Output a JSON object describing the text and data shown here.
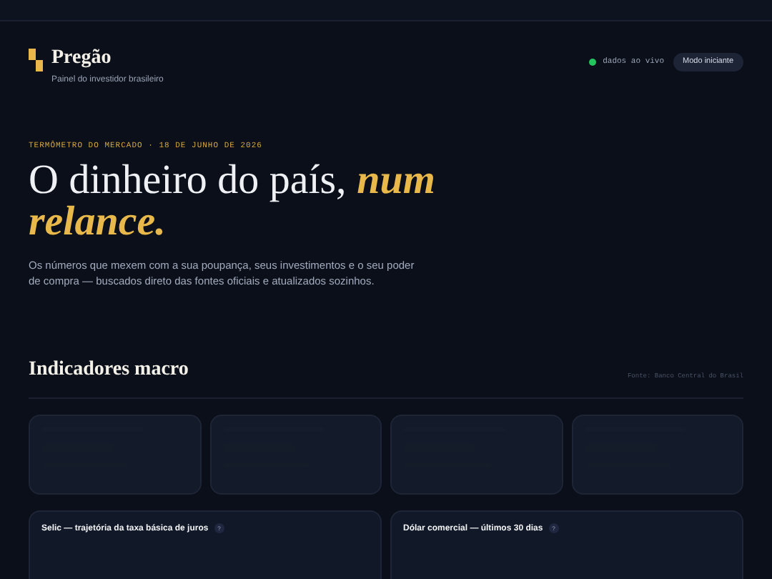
{
  "brand": {
    "name": "Pregão",
    "tagline": "Painel do investidor brasileiro"
  },
  "status": {
    "live": true,
    "label": "dados ao vivo"
  },
  "mode_button": "Modo iniciante",
  "hero": {
    "eyebrow": "TERMÔMETRO DO MERCADO · 18 DE JUNHO DE 2026",
    "headline": "O dinheiro do país, *num relance.*",
    "intro": "Os números que mexem com a sua poupança, seus investimentos e o seu poder de compra — buscados direto das fontes oficiais e atualizados sozinhos."
  },
  "section": {
    "title": "Indicadores macro",
    "source": "Fonte: Banco Central do Brasil"
  },
  "indicator_cards": [
    {
      "loading": true
    },
    {
      "loading": true
    },
    {
      "loading": true
    },
    {
      "loading": true
    }
  ],
  "chart_cards": [
    {
      "title": "Selic — trajetória da taxa básica de juros",
      "help": "?"
    },
    {
      "title": "Dólar comercial — últimos 30 dias",
      "help": "?"
    }
  ]
}
